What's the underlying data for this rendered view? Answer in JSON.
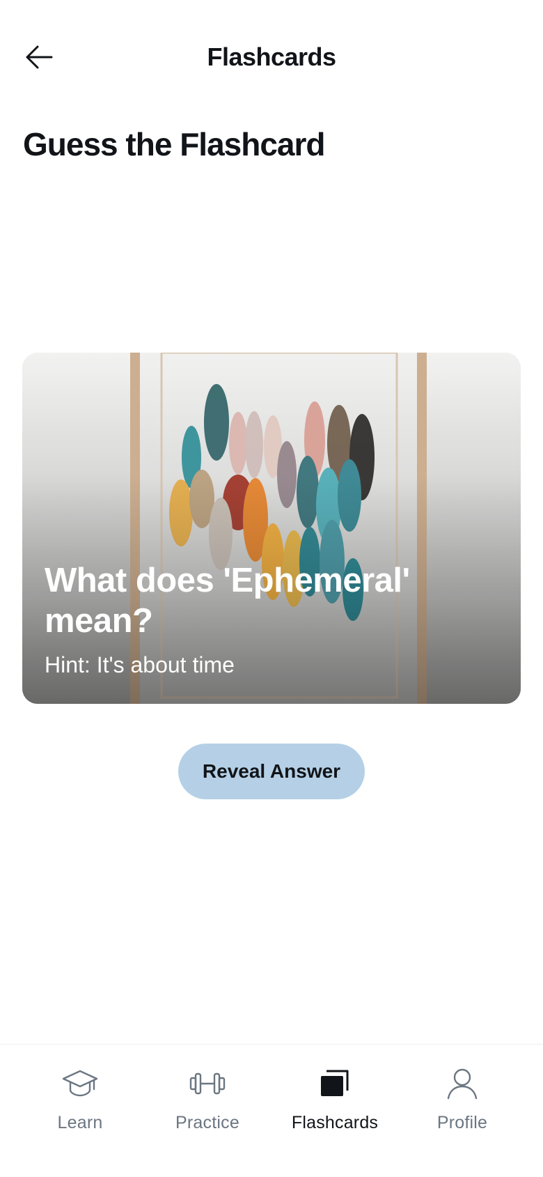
{
  "header": {
    "title": "Flashcards",
    "back_icon": "arrow-left-icon"
  },
  "page": {
    "title": "Guess the Flashcard"
  },
  "card": {
    "question": "What does 'Ephemeral' mean?",
    "hint": "Hint: It's about time",
    "image": "abstract-painting-in-frame"
  },
  "actions": {
    "reveal_label": "Reveal Answer"
  },
  "bottom_nav": {
    "items": [
      {
        "label": "Learn",
        "icon": "graduation-cap-icon",
        "active": false
      },
      {
        "label": "Practice",
        "icon": "dumbbell-icon",
        "active": false
      },
      {
        "label": "Flashcards",
        "icon": "cards-icon",
        "active": true
      },
      {
        "label": "Profile",
        "icon": "user-icon",
        "active": false
      }
    ]
  },
  "colors": {
    "accent_button": "#b5d0e6",
    "nav_inactive": "#6b7682",
    "text_primary": "#111418"
  }
}
